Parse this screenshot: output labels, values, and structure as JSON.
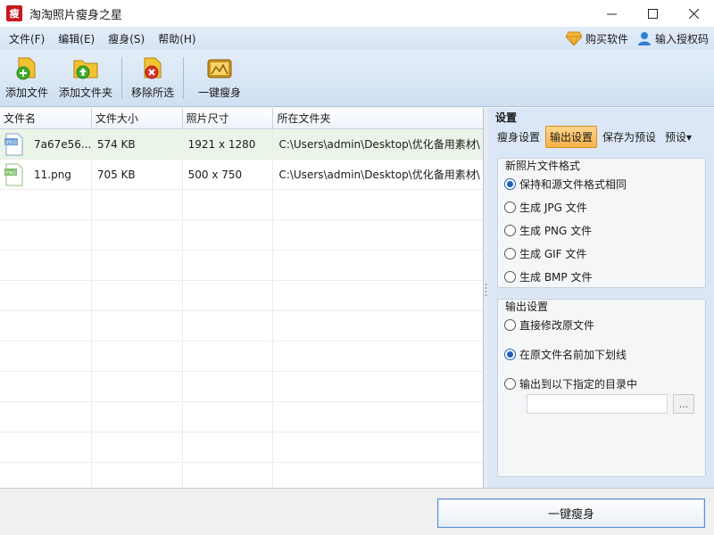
{
  "window": {
    "app_icon_text": "瘦",
    "title": "淘淘照片瘦身之星",
    "controls": [
      "minimize-icon",
      "maximize-icon",
      "close-icon"
    ]
  },
  "menubar": {
    "items": [
      "文件(F)",
      "编辑(E)",
      "瘦身(S)",
      "帮助(H)"
    ],
    "buy_label": "购买软件",
    "license_label": "输入授权码"
  },
  "toolbar": {
    "add_file": "添加文件",
    "add_folder": "添加文件夹",
    "remove_selected": "移除所选",
    "one_click_slim": "一键瘦身"
  },
  "filelist": {
    "columns": [
      "文件名",
      "文件大小",
      "照片尺寸",
      "所在文件夹"
    ],
    "rows": [
      {
        "type_badge": "JPEG",
        "name": "7a67e56...",
        "size": "574 KB",
        "dimensions": "1921 x 1280",
        "folder": "C:\\Users\\admin\\Desktop\\优化备用素材\\"
      },
      {
        "type_badge": "PNG",
        "name": "11.png",
        "size": "705 KB",
        "dimensions": "500 x 750",
        "folder": "C:\\Users\\admin\\Desktop\\优化备用素材\\"
      }
    ]
  },
  "settings": {
    "title": "设置",
    "tabs": [
      "瘦身设置",
      "输出设置",
      "保存为预设",
      "预设▾"
    ],
    "active_tab": "输出设置",
    "format_group": {
      "title": "新照片文件格式",
      "options": [
        "保持和源文件格式相同",
        "生成 JPG 文件",
        "生成 PNG 文件",
        "生成 GIF 文件",
        "生成 BMP 文件"
      ],
      "selected_index": 0
    },
    "output_group": {
      "title": "输出设置",
      "options": [
        "直接修改原文件",
        "在原文件名前加下划线",
        "输出到以下指定的目录中"
      ],
      "selected_index": 1,
      "dir_value": "",
      "browse_label": "..."
    }
  },
  "bottom": {
    "slim_button": "一键瘦身"
  },
  "colors": {
    "accent_blue": "#1f5fb8",
    "active_tab_orange": "#f7b24a",
    "selected_row": "#eaf5e8",
    "app_icon_red": "#c8181e"
  }
}
